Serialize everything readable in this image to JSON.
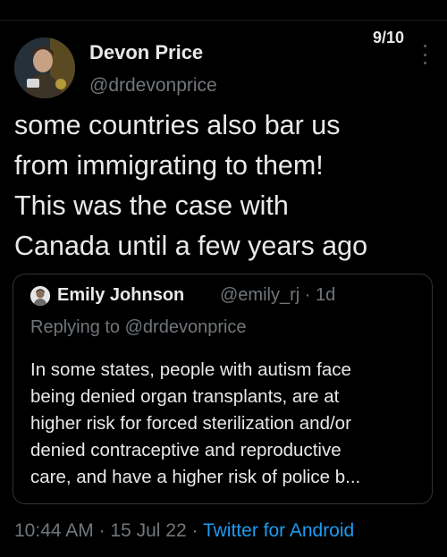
{
  "thread": {
    "counter": "9/10"
  },
  "author": {
    "name": "Devon Price",
    "handle": "@drdevonprice"
  },
  "tweet": {
    "lines": [
      "some countries also bar us",
      "from immigrating to them!",
      "This was the case with",
      "Canada until a few years ago"
    ]
  },
  "quote": {
    "name": "Emily Johnson",
    "handle": "@emily_rj",
    "separator": "·",
    "age": "1d",
    "reply": "Replying to @drdevonprice",
    "lines": [
      "In some states, people with autism face",
      "being denied organ transplants, are at",
      "higher risk for forced sterilization and/or",
      "denied contraceptive and reproductive",
      "care, and have a higher risk of police b..."
    ]
  },
  "footer": {
    "time": "10:44 AM",
    "date": "15 Jul 22",
    "separator": "·",
    "source": "Twitter for Android"
  },
  "colors": {
    "background": "#000000",
    "text": "#e7e9ea",
    "muted": "#71767b",
    "link": "#1d9bf0",
    "border": "#2f3336"
  },
  "icons": {
    "more": "more-vertical-icon"
  }
}
